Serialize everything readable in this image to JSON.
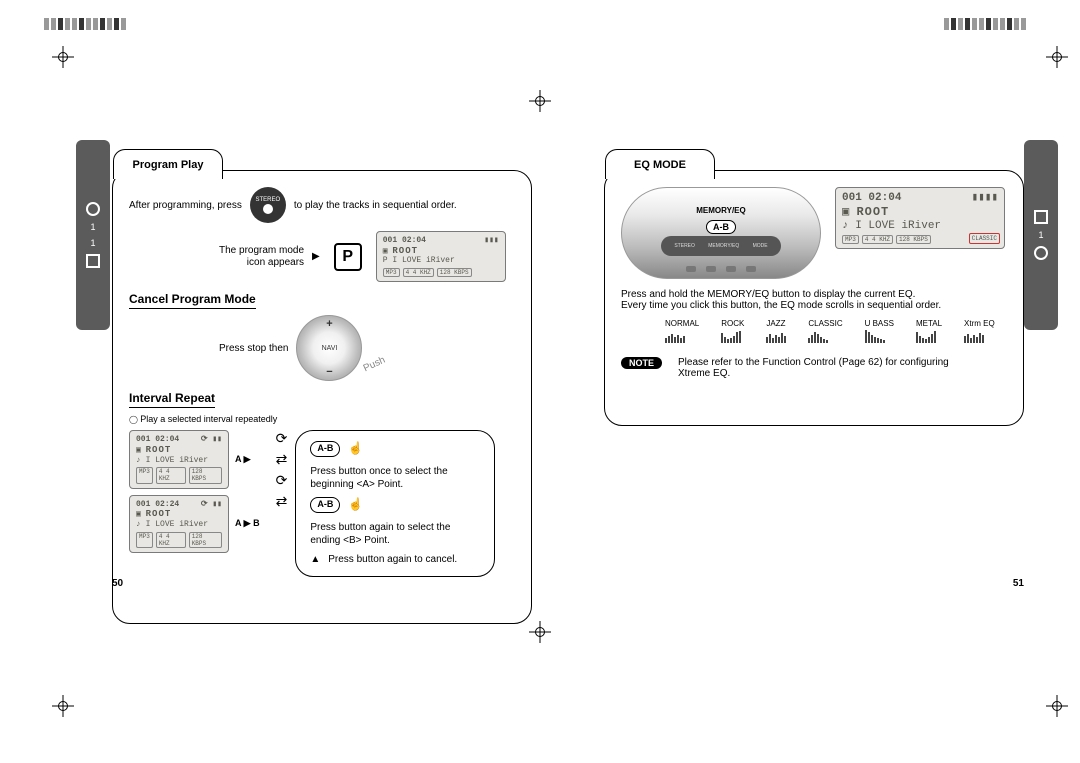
{
  "left": {
    "tab": "Program Play",
    "h1": "Program Play",
    "afterprog": "After programming, press",
    "playtracks": "to play the tracks in sequential order.",
    "progmode1": "The program mode",
    "progmode2": "icon appears",
    "pbox": "P",
    "h2": "Cancel Program Mode",
    "pressstop": "Press stop then",
    "h3": "Interval Repeat",
    "playinterval": "Play a selected interval repeatedly",
    "ab": "A-B",
    "ind_a": "A ▶",
    "ind_ab": "A ▶ B",
    "step1": "Press button once to select the beginning <A> Point.",
    "step2": "Press button again to select the ending <B> Point.",
    "step3": "Press button again to cancel.",
    "step3tri": "▲",
    "loop_refresh": "⟳",
    "loop_arrows": "⇄",
    "pagenum": "50"
  },
  "right": {
    "tab": "EQ MODE",
    "h1": "EQ MODE",
    "memeq": "MEMORY/EQ",
    "ab": "A-B",
    "ctrl": {
      "a": "STEREO",
      "b": "MEMORY/EQ",
      "c": "MODE"
    },
    "body1": "Press and hold the MEMORY/EQ button to display the current EQ.",
    "body2": "Every time you click this button, the EQ mode scrolls in sequential order.",
    "eqs": [
      "NORMAL",
      "ROCK",
      "JAZZ",
      "CLASSIC",
      "U BASS",
      "METAL",
      "Xtrm EQ"
    ],
    "note_label": "NOTE",
    "note_text": "Please refer to the Function Control (Page 62) for configuring Xtreme EQ.",
    "pagenum": "51"
  },
  "lcd": {
    "track": "001",
    "time": "02:04",
    "time2": "02:24",
    "root": "ROOT",
    "song": "I LOVE iRiver",
    "mp3": "MP3",
    "khz": "4 4 KHZ",
    "kbps": "128 KBPS",
    "classic": "CLASSIC",
    "stereo": "STEREO",
    "folder": "▣",
    "note": "♪",
    "p": "P"
  }
}
